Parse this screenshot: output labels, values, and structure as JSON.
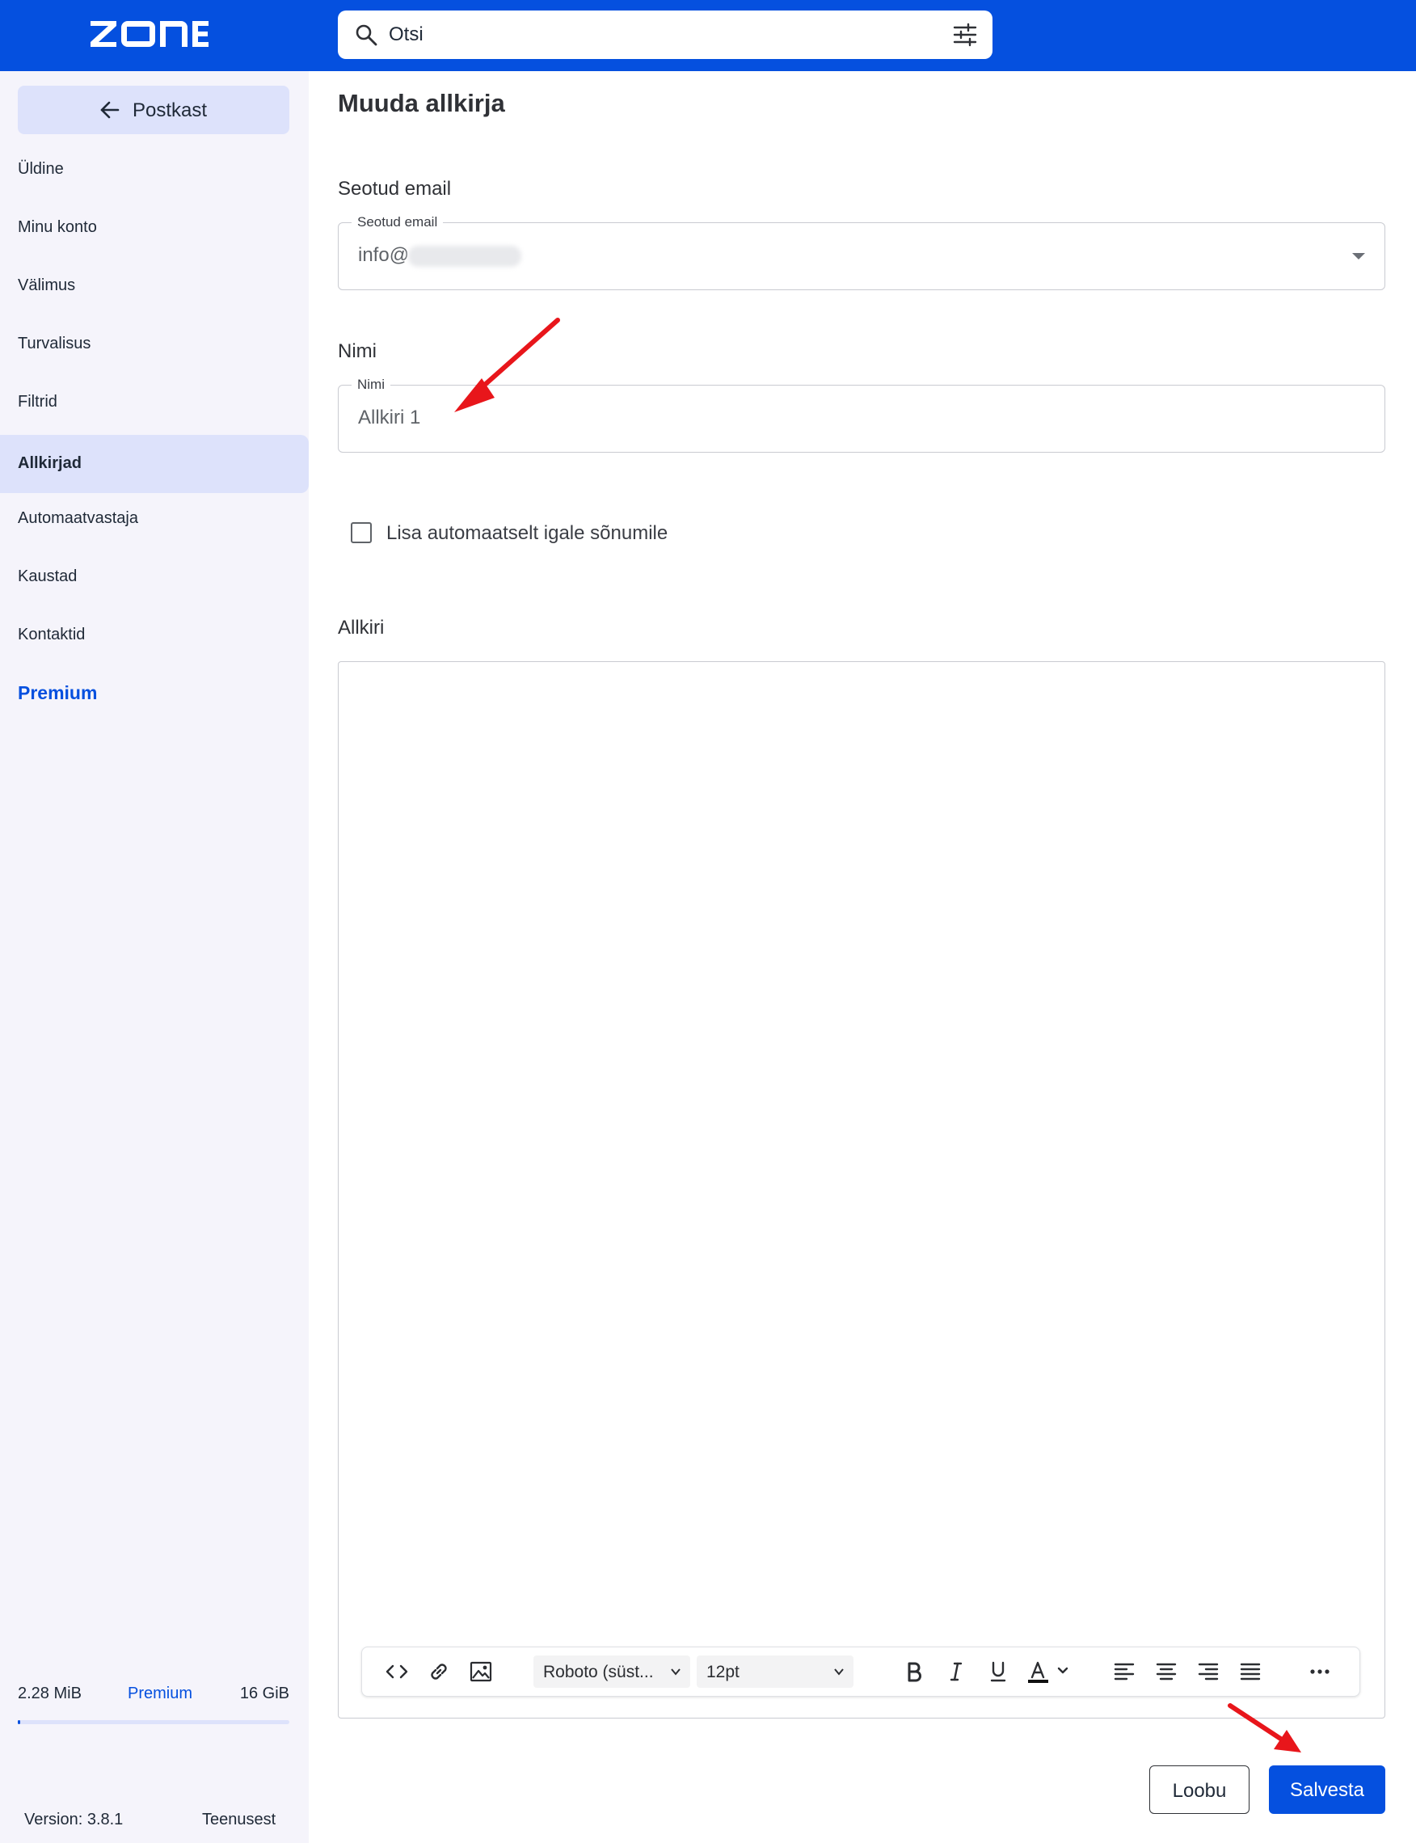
{
  "header": {
    "logo_text": "ZONE",
    "search": {
      "placeholder": "Otsi"
    }
  },
  "sidebar": {
    "back_label": "Postkast",
    "items": [
      {
        "label": "Üldine"
      },
      {
        "label": "Minu konto"
      },
      {
        "label": "Välimus"
      },
      {
        "label": "Turvalisus"
      },
      {
        "label": "Filtrid"
      },
      {
        "label": "Allkirjad",
        "active": true
      },
      {
        "label": "Automaatvastaja"
      },
      {
        "label": "Kaustad"
      },
      {
        "label": "Kontaktid"
      },
      {
        "label": "Premium"
      }
    ],
    "storage": {
      "used": "2.28 MiB",
      "plan": "Premium",
      "total": "16 GiB",
      "fill_fraction": 0.01
    },
    "version": "Version: 3.8.1",
    "terms": "Teenusest"
  },
  "main": {
    "title": "Muuda allkirja",
    "linked_email": {
      "section_label": "Seotud email",
      "field_label": "Seotud email",
      "value": "info@"
    },
    "name": {
      "section_label": "Nimi",
      "field_label": "Nimi",
      "value": "Allkiri 1"
    },
    "auto_add_label": "Lisa automaatselt igale sõnumile",
    "signature_label": "Allkiri",
    "toolbar": {
      "font": "Roboto (süst...",
      "size": "12pt"
    },
    "cancel_label": "Loobu",
    "save_label": "Salvesta"
  },
  "colors": {
    "brand": "#0550df",
    "active_item_bg": "#dde2fb",
    "sidebar_bg": "#f5f4fb",
    "annotation_arrow": "#e8161b"
  }
}
